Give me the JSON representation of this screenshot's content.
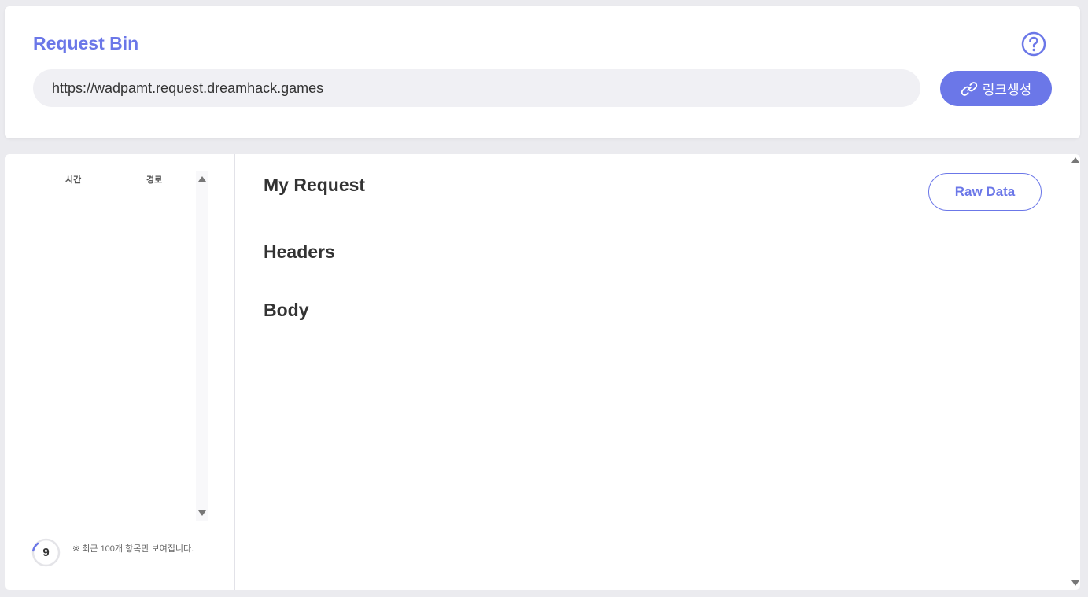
{
  "header": {
    "brand": "Request Bin",
    "help_icon": "question-circle-icon",
    "url_value": "https://wadpamt.request.dreamhack.games",
    "generate_label": "링크생성",
    "generate_icon": "link-icon"
  },
  "sidebar": {
    "col_time": "시간",
    "col_path": "경로",
    "count": "9",
    "note": "※ 최근 100개 항목만 보여집니다."
  },
  "main": {
    "title": "My Request",
    "raw_label": "Raw Data",
    "headers_title": "Headers",
    "body_title": "Body"
  },
  "colors": {
    "accent": "#6b77e8",
    "background": "#ebebef",
    "input_bg": "#f0f0f4"
  }
}
